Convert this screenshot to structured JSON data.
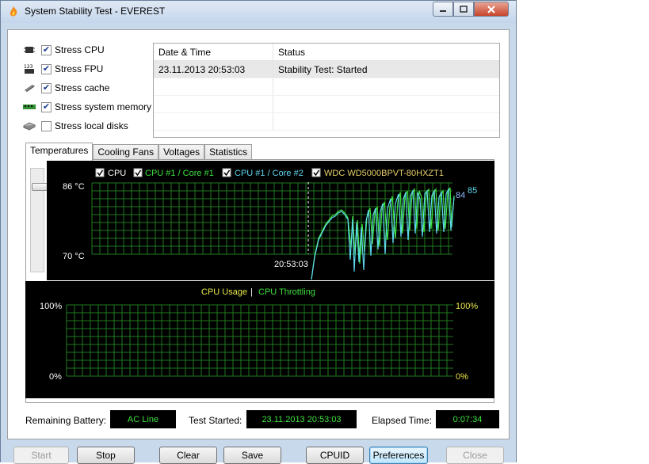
{
  "window": {
    "title": "System Stability Test - EVEREST"
  },
  "options": [
    {
      "label": "Stress CPU",
      "checked": true,
      "icon": "cpu-chip-icon"
    },
    {
      "label": "Stress FPU",
      "checked": true,
      "icon": "fpu-123-icon"
    },
    {
      "label": "Stress cache",
      "checked": true,
      "icon": "cache-chip-icon"
    },
    {
      "label": "Stress system memory",
      "checked": true,
      "icon": "memory-module-icon"
    },
    {
      "label": "Stress local disks",
      "checked": false,
      "icon": "hard-disk-icon"
    }
  ],
  "log": {
    "headers": [
      "Date & Time",
      "Status"
    ],
    "rows": [
      {
        "datetime": "23.11.2013 20:53:03",
        "status": "Stability Test: Started"
      }
    ]
  },
  "tabs": [
    "Temperatures",
    "Cooling Fans",
    "Voltages",
    "Statistics"
  ],
  "temperatures": {
    "legend": [
      {
        "label": "CPU",
        "color": "#ffffff"
      },
      {
        "label": "CPU #1 / Core #1",
        "color": "#3ee23e"
      },
      {
        "label": "CPU #1 / Core #2",
        "color": "#5fd7f0"
      },
      {
        "label": "WDC WD5000BPVT-80HXZT1",
        "color": "#e8d06a"
      }
    ],
    "y_top_label": "86 °C",
    "y_bottom_label": "70 °C",
    "marker_time": "20:53:03",
    "end_values": [
      {
        "text": "84",
        "color": "#8fb6ff"
      },
      {
        "text": "85",
        "color": "#5fd7f0"
      }
    ]
  },
  "usage": {
    "title_left": "CPU Usage",
    "separator": "|",
    "title_right": "CPU Throttling",
    "left_top": "100%",
    "left_bottom": "0%",
    "right_top": "100%",
    "right_bottom": "0%"
  },
  "status": {
    "battery_label": "Remaining Battery:",
    "battery_value": "AC Line",
    "started_label": "Test Started:",
    "started_value": "23.11.2013 20:53:03",
    "elapsed_label": "Elapsed Time:",
    "elapsed_value": "0:07:34"
  },
  "buttons": {
    "start": "Start",
    "stop": "Stop",
    "clear": "Clear",
    "save": "Save",
    "cpuid": "CPUID",
    "preferences": "Preferences",
    "close": "Close"
  }
}
